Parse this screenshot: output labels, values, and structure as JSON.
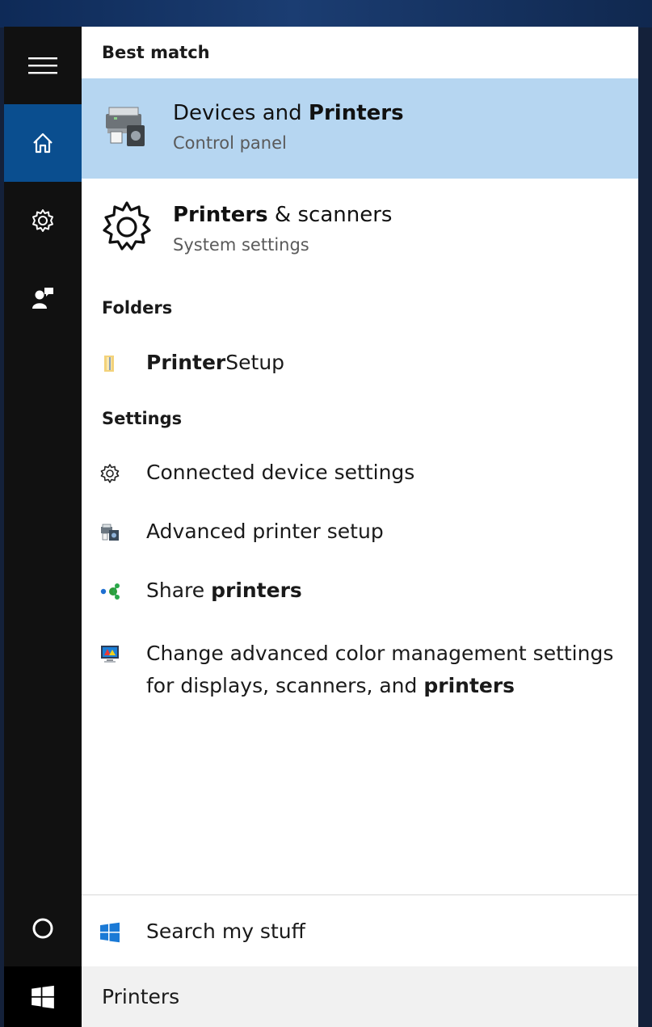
{
  "sections": {
    "best_match": "Best match",
    "folders": "Folders",
    "settings": "Settings"
  },
  "best_match": {
    "title_pre": "Devices and ",
    "title_bold": "Printers",
    "subtitle": "Control panel"
  },
  "app_result": {
    "title_bold": "Printers",
    "title_post": " & scanners",
    "subtitle": "System settings"
  },
  "folder_item": {
    "label_bold": "Printer",
    "label_post": "Setup"
  },
  "settings_items": [
    {
      "pre": "Connected device settings",
      "bold": "",
      "icon": "gear-icon"
    },
    {
      "pre": "Advanced printer setup",
      "bold": "",
      "icon": "printer-icon"
    },
    {
      "pre": "Share ",
      "bold": "printers",
      "icon": "share-icon"
    },
    {
      "pre": "Change advanced color management settings for displays, scanners, and ",
      "bold": "printers",
      "icon": "monitor-color-icon"
    }
  ],
  "search_my_stuff": "Search my stuff",
  "search_query": "Printers",
  "colors": {
    "rail": "#111111",
    "rail_active": "#0a4e8f",
    "selected_result": "#b6d6f1",
    "search_box": "#f1f1f1"
  }
}
